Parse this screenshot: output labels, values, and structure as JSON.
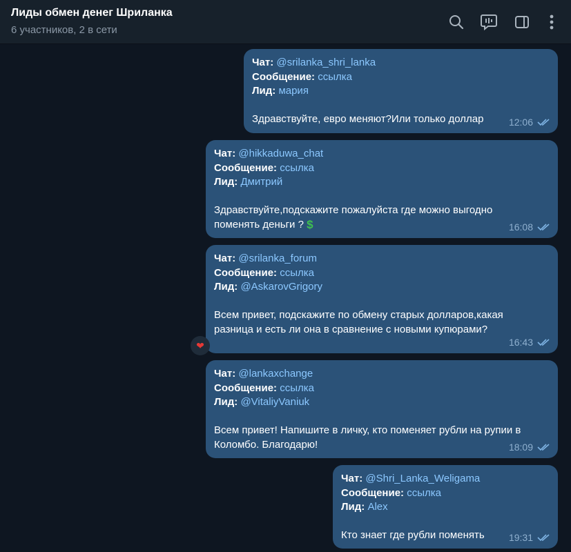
{
  "header": {
    "title": "Лиды обмен денег Шриланка",
    "subtitle": "6 участников, 2 в сети",
    "icons": [
      "search-icon",
      "live-chat-icon",
      "sidebar-toggle-icon",
      "more-icon"
    ]
  },
  "labels": {
    "chat": "Чат:",
    "message": "Сообщение:",
    "lead": "Лид:"
  },
  "messages": [
    {
      "chat": "@srilanka_shri_lanka",
      "message": "ссылка",
      "lead": "мария",
      "text_lines": [
        "Здравствуйте, евро меняют?Или только доллар"
      ],
      "time": "12:06"
    },
    {
      "chat": "@hikkaduwa_chat",
      "message": "ссылка",
      "lead": "Дмитрий",
      "text_lines": [
        "Здравствуйте,подскажите пожалуйста  где можно выгодно",
        "поменять деньги ?"
      ],
      "emoji": "$",
      "time": "16:08"
    },
    {
      "chat": "@srilanka_forum",
      "message": "ссылка",
      "lead": "@AskarovGrigory",
      "text_lines": [
        "Всем привет, подскажите по обмену старых долларов,какая",
        "разница и есть ли она в сравнение с новыми купюрами?"
      ],
      "reaction": "❤",
      "time": "16:43"
    },
    {
      "chat": "@lankaxchange",
      "message": "ссылка",
      "lead": "@VitaliyVaniuk",
      "text_lines": [
        "Всем привет! Напишите в личку, кто поменяет рубли на рупии в",
        "Коломбо. Благодарю!"
      ],
      "time": "18:09"
    },
    {
      "chat": "@Shri_Lanka_Weligama",
      "message": "ссылка",
      "lead": "Alex",
      "text_lines": [
        "Кто знает где рубли поменять"
      ],
      "time": "19:31"
    }
  ],
  "colors": {
    "background": "#0e1621",
    "header": "#17212b",
    "bubble": "#2b5278",
    "link": "#8cc8ff",
    "meta": "#8fb0cf"
  }
}
